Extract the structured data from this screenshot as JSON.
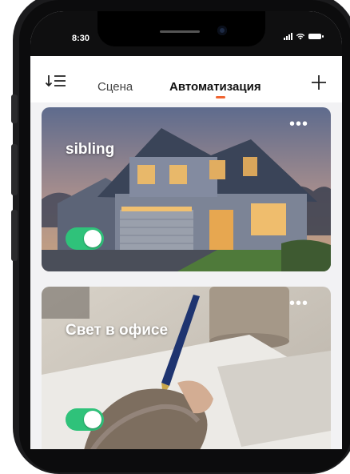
{
  "status_bar": {
    "time": "8:30"
  },
  "header": {
    "tabs": [
      {
        "label": "Сцена",
        "active": false
      },
      {
        "label": "Автоматизация",
        "active": true
      }
    ],
    "accent_color": "#f06431"
  },
  "cards": [
    {
      "title": "sibling",
      "enabled": true,
      "image": "house-photo"
    },
    {
      "title": "Свет в офисе",
      "enabled": true,
      "image": "office-desk-photo"
    }
  ],
  "colors": {
    "toggle_on": "#2fc27a"
  }
}
